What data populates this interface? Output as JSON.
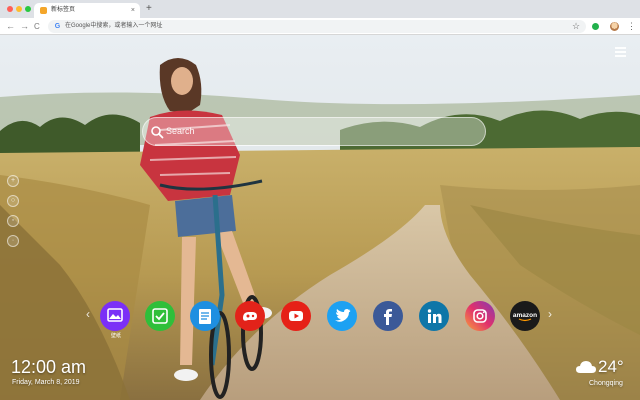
{
  "browser": {
    "tab_title": "新标签页",
    "tab_close": "×",
    "new_tab": "+",
    "nav_back": "←",
    "nav_forward": "→",
    "nav_reload": "C",
    "address_placeholder": "在Google中搜索，或者输入一个网址",
    "google_glyph": "G",
    "bookmark_glyph": "☆",
    "menu_glyph": "⋮",
    "colors": {
      "close": "#ff5f57",
      "minimize": "#febc2e",
      "maximize": "#28c840",
      "extension": "#22b14c"
    }
  },
  "page": {
    "search": {
      "placeholder": "Search"
    },
    "dock": {
      "items": [
        {
          "name": "wallpaper-app-icon",
          "label": "壁纸",
          "color": "#7b2ff7"
        },
        {
          "name": "tasks-app-icon",
          "label": "",
          "color": "#2fbf3a"
        },
        {
          "name": "notes-app-icon",
          "label": "",
          "color": "#1e8fe1"
        },
        {
          "name": "game-app-icon",
          "label": "",
          "color": "#e2231a"
        },
        {
          "name": "youtube-icon",
          "label": "",
          "color": "#e62117"
        },
        {
          "name": "twitter-icon",
          "label": "",
          "color": "#1da1f2"
        },
        {
          "name": "facebook-icon",
          "label": "",
          "color": "#3b5998"
        },
        {
          "name": "linkedin-icon",
          "label": "",
          "color": "#0e76a8"
        },
        {
          "name": "instagram-icon",
          "label": "",
          "color": "#c13584"
        },
        {
          "name": "amazon-icon",
          "label": "amazon",
          "color": "#1a1a1a"
        }
      ],
      "prev_glyph": "‹",
      "next_glyph": "›"
    },
    "clock": {
      "time": "12:00 am",
      "date": "Friday, March 8, 2019"
    },
    "weather": {
      "temperature": "24°",
      "city": "Chongqing",
      "icon": "cloud-icon"
    }
  }
}
